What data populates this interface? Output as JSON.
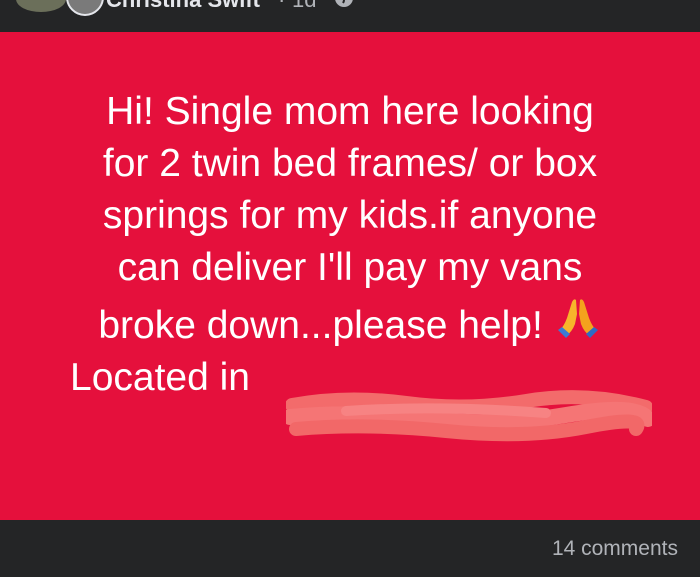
{
  "header": {
    "author_name": "Christina Swift",
    "separator": "·",
    "time": "1d",
    "privacy_icon": "globe-icon"
  },
  "status": {
    "background_color": "#e5103c",
    "text_color": "#ffffff",
    "lines": [
      "Hi! Single mom here looking",
      "for 2 twin bed frames/ or box",
      "springs for my kids.if anyone",
      "can deliver I'll pay my vans",
      "broke down...please help!",
      "Located in"
    ],
    "emoji": "folded-hands-icon",
    "redaction": "redacted-location"
  },
  "footer": {
    "comments": "14 comments"
  }
}
